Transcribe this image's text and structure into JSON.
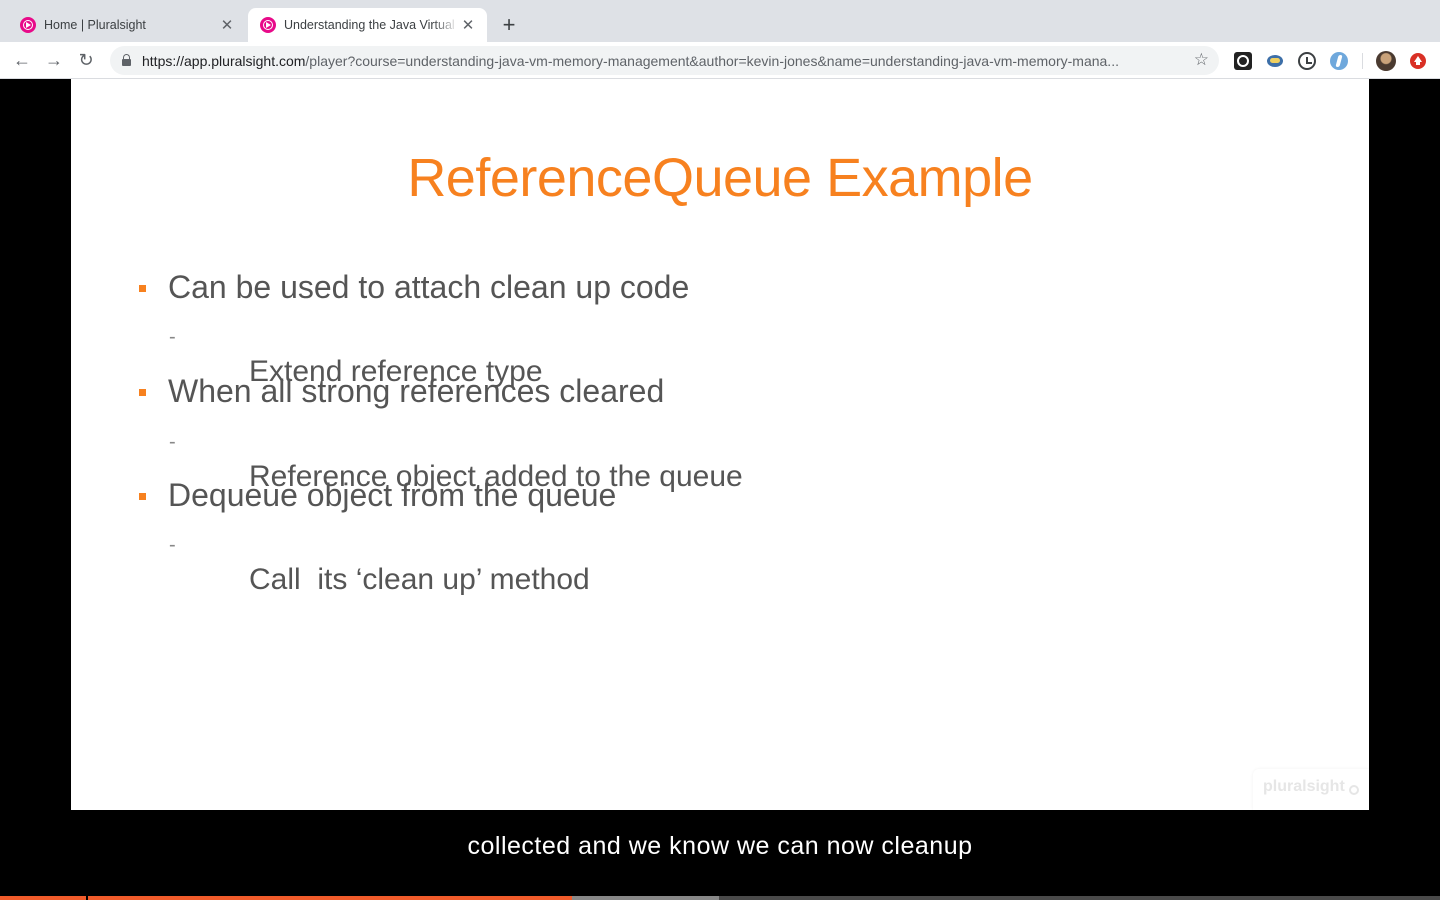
{
  "browser": {
    "tabs": [
      {
        "title": "Home | Pluralsight",
        "active": false
      },
      {
        "title": "Understanding the Java Virtual Machine: Memory Management",
        "active": true
      }
    ],
    "url_host": "https://app.pluralsight.com",
    "url_path": "/player?course=understanding-java-vm-memory-management&author=kevin-jones&name=understanding-java-vm-memory-mana...",
    "icons": {
      "back": "arrow-left-icon",
      "forward": "arrow-right-icon",
      "reload": "reload-icon",
      "secure": "lock-icon",
      "bookmark": "star-icon",
      "close": "close-icon",
      "new_tab": "plus-icon"
    },
    "colors": {
      "accent": "#f15b2a",
      "favicon": "#e80a89"
    }
  },
  "slide": {
    "title": "ReferenceQueue Example",
    "bullets": [
      {
        "text": "Can be used to attach clean up code",
        "sub": "Extend reference type"
      },
      {
        "text": "When all strong references cleared",
        "sub": "Reference object added to the queue"
      },
      {
        "text": "Dequeue object from the queue",
        "sub": "Call  its ‘clean up’ method"
      }
    ],
    "watermark": "pluralsight",
    "colors": {
      "title": "#f7811f",
      "text": "#555555"
    }
  },
  "player": {
    "caption": "collected and we know we can now cleanup",
    "progress_played": 0.397,
    "progress_buffered": 0.499
  }
}
